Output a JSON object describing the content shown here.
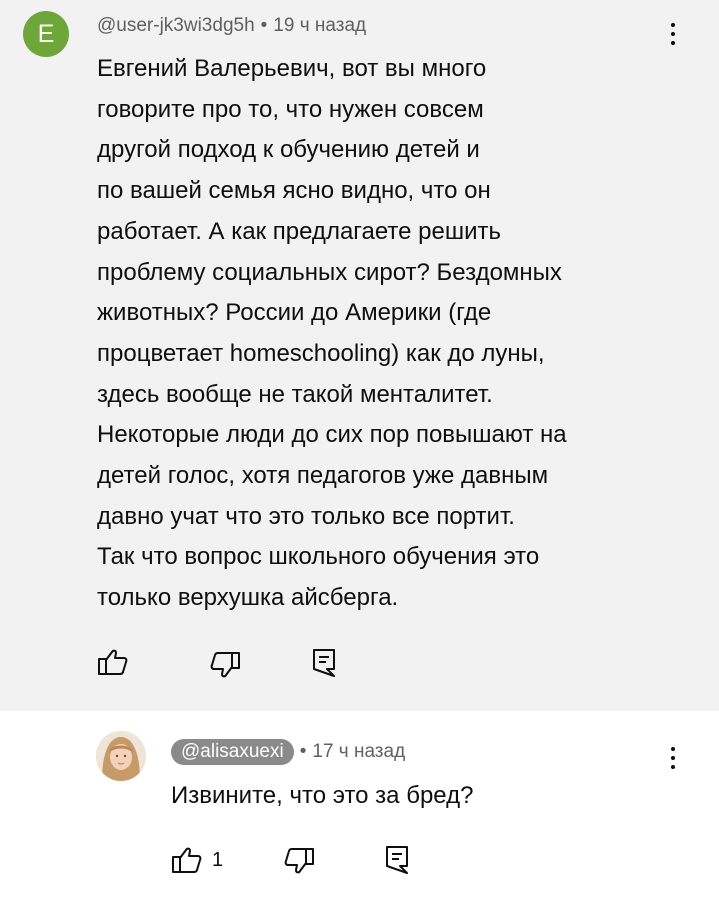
{
  "comment": {
    "avatar_letter": "E",
    "handle": "@user-jk3wi3dg5h",
    "separator": "•",
    "time": "19 ч назад",
    "lines": [
      "Евгений Валерьевич, вот вы много",
      "говорите про то, что нужен совсем",
      "другой подход к обучению детей и",
      "по вашей семья ясно видно, что он",
      "работает. А как предлагаете решить",
      "проблему социальных сирот? Бездомных",
      "животных? России до Америки (где",
      "процветает homeschooling) как до луны,",
      "здесь вообще не такой менталитет.",
      "Некоторые люди до сих пор повышают на",
      "детей голос, хотя педагогов уже давным",
      "давно учат что это только все портит.",
      "Так что вопрос школьного обучения это",
      "только верхушка айсберга."
    ],
    "avatar_color": "#6ea63a",
    "background": "#f2f2f2"
  },
  "reply": {
    "handle": "@alisaxuexi",
    "separator": "•",
    "time": "17 ч назад",
    "text": "Извините, что это за бред?",
    "like_count": "1"
  },
  "icons": {
    "like": "thumb-up-icon",
    "dislike": "thumb-down-icon",
    "reply": "comment-reply-icon",
    "menu": "more-vertical-icon"
  }
}
